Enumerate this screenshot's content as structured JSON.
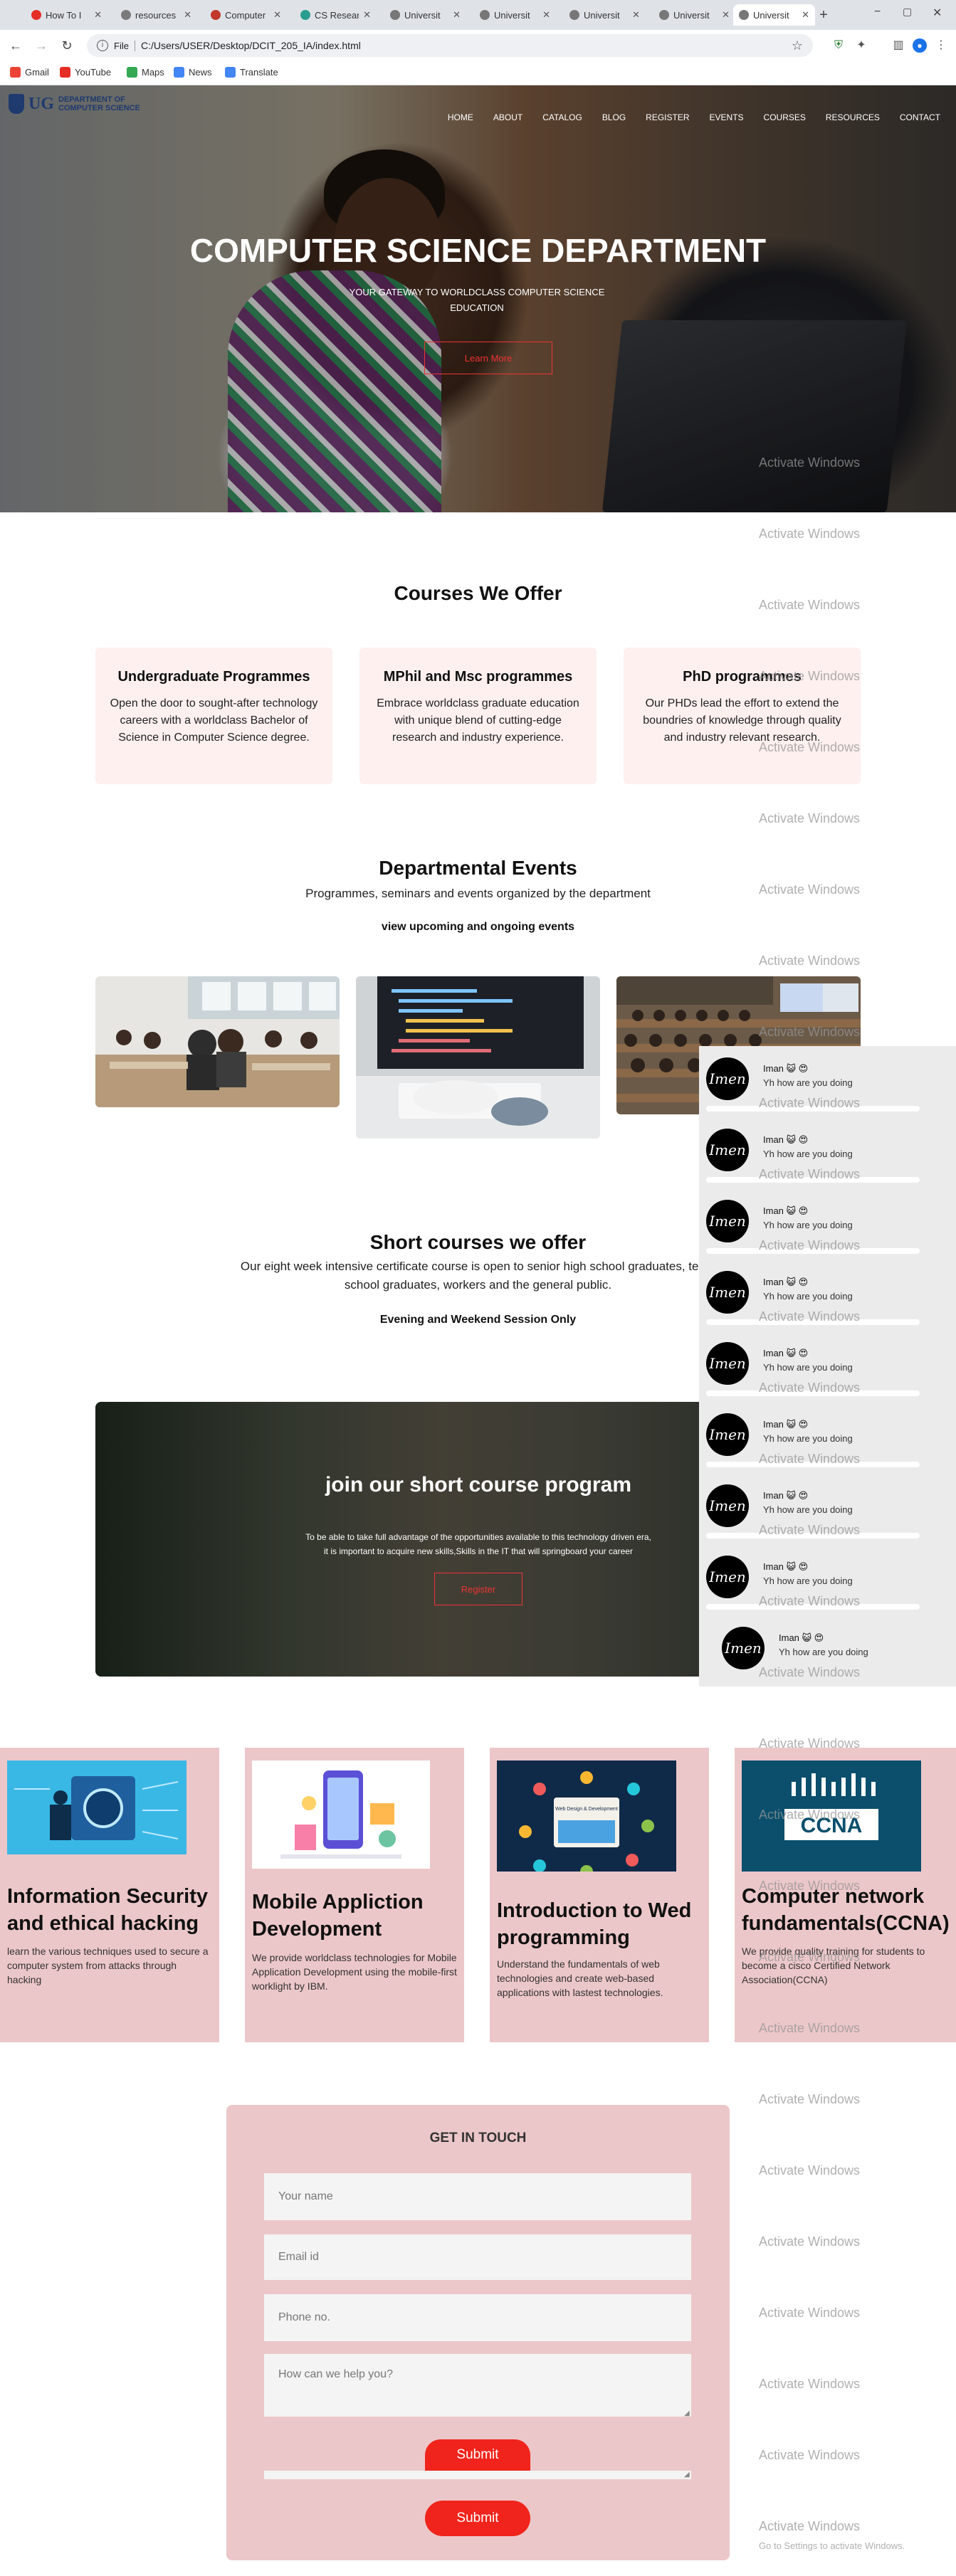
{
  "browser": {
    "tabs": [
      {
        "label": "How To I",
        "color": "#e52d27"
      },
      {
        "label": "resources",
        "color": "#7a7a7a"
      },
      {
        "label": "Computer",
        "color": "#c0392b"
      },
      {
        "label": "CS Resear",
        "color": "#2a9d8f"
      },
      {
        "label": "Universit",
        "color": "#777777"
      },
      {
        "label": "Universit",
        "color": "#777777"
      },
      {
        "label": "Universit",
        "color": "#777777"
      },
      {
        "label": "Universit",
        "color": "#777777"
      },
      {
        "label": "Universit",
        "color": "#777777"
      }
    ],
    "url_chip": "File",
    "url": "C:/Users/USER/Desktop/DCIT_205_IA/index.html",
    "bookmarks": [
      {
        "label": "Gmail",
        "color": "#ea4335"
      },
      {
        "label": "YouTube",
        "color": "#e52d27"
      },
      {
        "label": "Maps",
        "color": "#34a853"
      },
      {
        "label": "News",
        "color": "#4285f4"
      },
      {
        "label": "Translate",
        "color": "#4285f4"
      }
    ]
  },
  "site": {
    "logo_text": "UG",
    "logo_dept_line1": "DEPARTMENT OF",
    "logo_dept_line2": "COMPUTER SCIENCE",
    "nav": [
      "HOME",
      "ABOUT",
      "CATALOG",
      "BLOG",
      "REGISTER",
      "EVENTS",
      "COURSES",
      "RESOURCES",
      "CONTACT"
    ],
    "hero": {
      "title": "COMPUTER SCIENCE DEPARTMENT",
      "subtitle_line1": "YOUR GATEWAY TO WORLDCLASS COMPUTER SCIENCE",
      "subtitle_line2": "EDUCATION",
      "button": "Learn More"
    },
    "courses": {
      "heading": "Courses We Offer",
      "items": [
        {
          "title": "Undergraduate Programmes",
          "text": "Open the door to sought-after technology careers with a worldclass Bachelor of Science in Computer Science degree."
        },
        {
          "title": "MPhil and Msc programmes",
          "text": "Embrace worldclass graduate education with unique blend of cutting-edge research and industry experience."
        },
        {
          "title": "PhD programmes",
          "text": "Our PHDs lead the effort to extend the boundries of knowledge through quality and industry relevant research."
        }
      ]
    },
    "events": {
      "heading": "Departmental Events",
      "subtitle": "Programmes, seminars and events organized by the department",
      "link": "view upcoming and ongoing events"
    },
    "short_courses": {
      "heading": "Short courses we offer",
      "text_line1": "Our eight week intensive certificate course is open to senior high school graduates, tertia",
      "text_line2": "school graduates, workers and the general public.",
      "note": "Evening and Weekend Session Only",
      "card_title": "join our short course program",
      "card_text_line1": "To be able to take full advantage of the opportunities available to this technology driven era,",
      "card_text_line2": "it is important to acquire new skills,Skills in the IT that will springboard your career",
      "card_button": "Register"
    },
    "topics": [
      {
        "title": "Information Security and ethical hacking",
        "text": "learn the various techniques used to secure a computer system from attacks through hacking"
      },
      {
        "title": "Mobile Appliction Development",
        "text": "We provide worldclass technologies for Mobile Application Development using the mobile-first worklight by IBM."
      },
      {
        "title": "Introduction to Wed programming",
        "text": "Understand the fundamentals of web technologies and create web-based applications with lastest technologies."
      },
      {
        "title": "Computer network fundamentals(CCNA)",
        "text": "We provide quality training for students to become a cisco Certified Network Association(CCNA)"
      }
    ],
    "topic_image_text": {
      "web_design": "Web Design & Development",
      "ccna": "CCNA"
    },
    "contact": {
      "heading": "GET IN TOUCH",
      "name_placeholder": "Your name",
      "email_placeholder": "Email id",
      "phone_placeholder": "Phone no.",
      "message_placeholder": "How can we help you?",
      "submit": "Submit"
    }
  },
  "chat": {
    "avatar_text": "Imen",
    "messages": [
      {
        "name": "Iman 😺 😍",
        "text": "Yh how are you doing"
      },
      {
        "name": "Iman 😺 😍",
        "text": "Yh how are you doing"
      },
      {
        "name": "Iman 😺 😍",
        "text": "Yh how are you doing"
      },
      {
        "name": "Iman 😺 😍",
        "text": "Yh how are you doing"
      },
      {
        "name": "Iman 😺 😍",
        "text": "Yh how are you doing"
      },
      {
        "name": "Iman 😺 😍",
        "text": "Yh how are you doing"
      },
      {
        "name": "Iman 😺 😍",
        "text": "Yh how are you doing"
      },
      {
        "name": "Iman 😺 😍",
        "text": "Yh how are you doing"
      },
      {
        "name": "Iman 😺 😍",
        "text": "Yh how are you doing"
      }
    ]
  },
  "watermark": {
    "text": "Activate Windows",
    "subtext": "Go to Settings to activate Windows."
  }
}
